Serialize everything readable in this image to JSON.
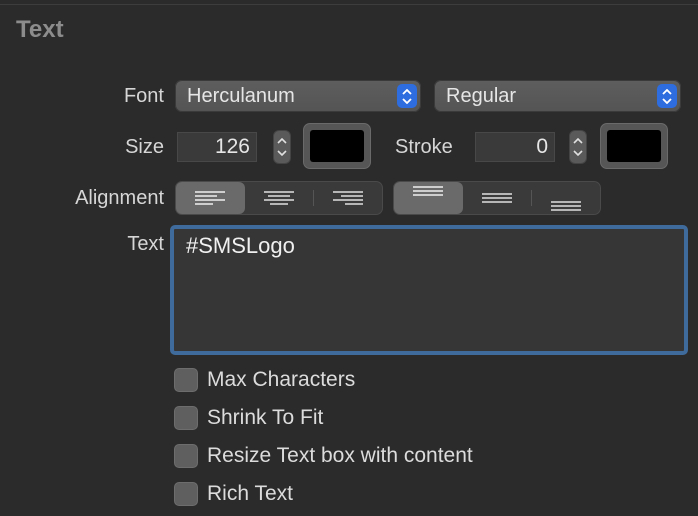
{
  "section": {
    "title": "Text"
  },
  "font": {
    "label": "Font",
    "family": "Herculanum",
    "style": "Regular"
  },
  "size": {
    "label": "Size",
    "value": "126",
    "color": "#000000"
  },
  "stroke": {
    "label": "Stroke",
    "value": "0",
    "color": "#000000"
  },
  "alignment": {
    "label": "Alignment",
    "horizontal": [
      "left-align-icon",
      "center-align-icon",
      "right-align-icon"
    ],
    "horizontal_selected": "left-align-icon",
    "vertical": [
      "top-align-icon",
      "middle-align-icon",
      "bottom-align-icon"
    ],
    "vertical_selected": "top-align-icon"
  },
  "text": {
    "label": "Text",
    "value": "#SMSLogo"
  },
  "options": [
    {
      "label": "Max Characters",
      "checked": false
    },
    {
      "label": "Shrink To Fit",
      "checked": false
    },
    {
      "label": "Resize Text box with content",
      "checked": false
    },
    {
      "label": "Rich Text",
      "checked": false
    }
  ],
  "colors": {
    "accent": "#2e6de0",
    "focus_ring": "#3f6b9c",
    "background": "#2b2b2b"
  }
}
